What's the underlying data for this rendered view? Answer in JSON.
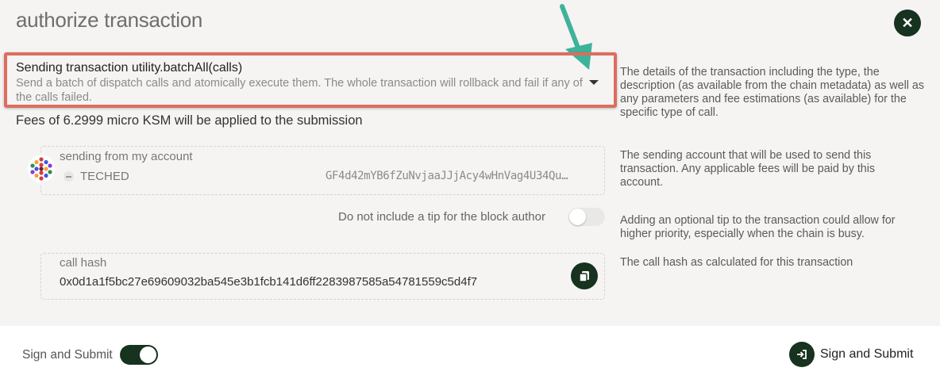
{
  "modal": {
    "title": "authorize transaction",
    "close_icon": "close-icon"
  },
  "transaction": {
    "title": "Sending transaction utility.batchAll(calls)",
    "description": "Send a batch of dispatch calls and atomically execute them. The whole transaction will rollback and fail if any of the calls failed.",
    "expand_icon": "chevron-down-icon",
    "fees": "Fees of 6.2999 micro KSM will be applied to the submission"
  },
  "help": {
    "transaction": "The details of the transaction including the type, the description (as available from the chain metadata) as well as any parameters and fee estimations (as available) for the specific type of call.",
    "account": "The sending account that will be used to send this transaction. Any applicable fees will be paid by this account.",
    "tip": "Adding an optional tip to the transaction could allow for higher priority, especially when the chain is busy.",
    "hash": "The call hash as calculated for this transaction"
  },
  "account": {
    "label": "sending from my account",
    "name": "TECHED",
    "address": "GF4d42mYB6fZuNvjaaJJjAcy4wHnVag4U34Qu…"
  },
  "tip": {
    "label": "Do not include a tip for the block author",
    "enabled": false
  },
  "call_hash": {
    "label": "call hash",
    "value": "0x0d1a1f5bc27e69609032ba545e3b1fcb141d6ff2283987585a54781559c5d4f7",
    "copy_icon": "copy-icon"
  },
  "footer": {
    "toggle_label": "Sign and Submit",
    "toggle_enabled": true,
    "submit_label": "Sign and Submit",
    "submit_icon": "sign-in-icon"
  },
  "colors": {
    "accent": "#17321f",
    "highlight_border": "#dc6e60",
    "annotation_arrow": "#3fb39a",
    "background": "#f5f4f3"
  }
}
